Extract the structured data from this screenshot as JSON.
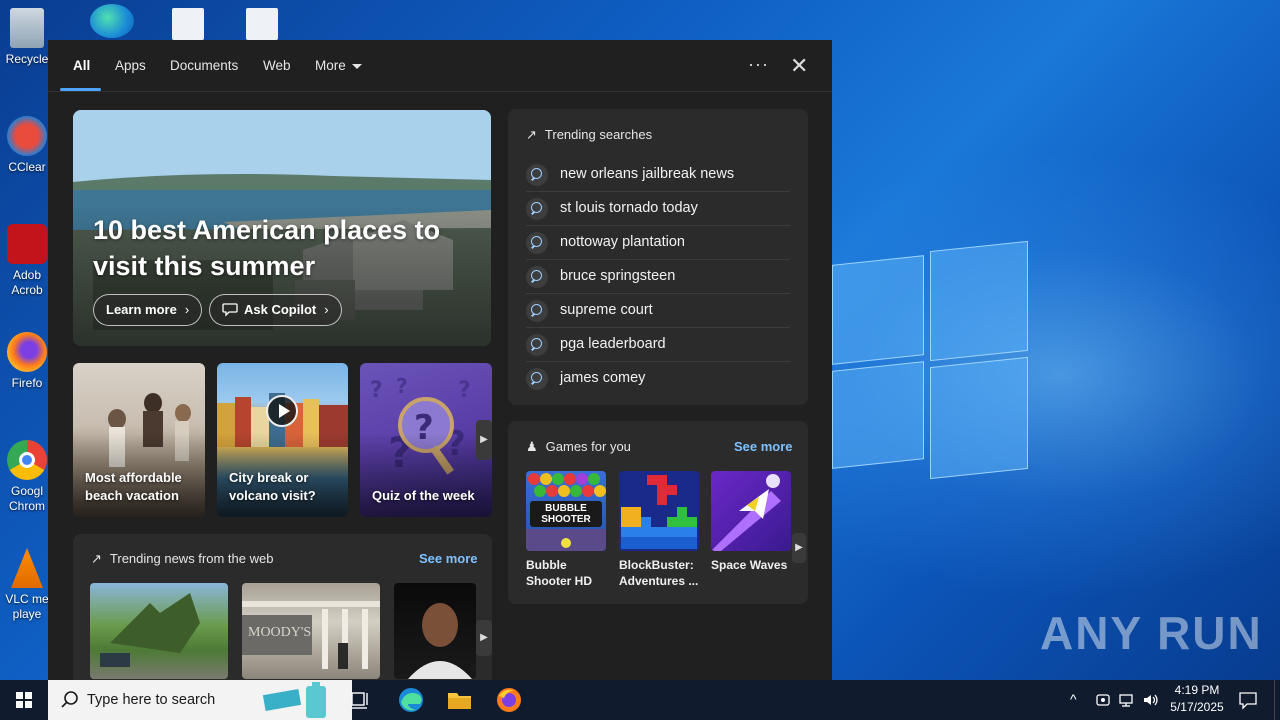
{
  "desktop": {
    "icons": [
      {
        "label": "Recycle",
        "name": "recycle-bin"
      },
      {
        "label": "CClear",
        "name": "ccleaner"
      },
      {
        "label": "Adob Acrob",
        "name": "adobe-acrobat"
      },
      {
        "label": "Firefo",
        "name": "firefox"
      },
      {
        "label": "Googl Chrom",
        "name": "google-chrome"
      },
      {
        "label": "VLC me playe",
        "name": "vlc-player"
      }
    ]
  },
  "panel": {
    "tabs": [
      {
        "label": "All",
        "active": true
      },
      {
        "label": "Apps"
      },
      {
        "label": "Documents"
      },
      {
        "label": "Web"
      },
      {
        "label": "More"
      }
    ],
    "options_icon": "···",
    "close_icon": "✕"
  },
  "hero": {
    "title": "10 best American places to visit this summer",
    "learn_more": "Learn more",
    "ask_copilot": "Ask Copilot"
  },
  "cards": [
    {
      "label": "Most affordable beach vacation"
    },
    {
      "label": "City break or volcano visit?"
    },
    {
      "label": "Quiz of the week"
    }
  ],
  "news": {
    "title": "Trending news from the web",
    "see_more": "See more",
    "thumb2_text": "MOODY'S"
  },
  "trending": {
    "title": "Trending searches",
    "items": [
      "new orleans jailbreak news",
      "st louis tornado today",
      "nottoway plantation",
      "bruce springsteen",
      "supreme court",
      "pga leaderboard",
      "james comey"
    ]
  },
  "games": {
    "title": "Games for you",
    "see_more": "See more",
    "items": [
      {
        "name": "Bubble Shooter HD",
        "art": "BUBBLE SHOOTER"
      },
      {
        "name": "BlockBuster: Adventures ..."
      },
      {
        "name": "Space Waves"
      }
    ]
  },
  "taskbar": {
    "search_placeholder": "Type here to search",
    "time": "4:19 PM",
    "date": "5/17/2025"
  },
  "watermark": "ANY RUN"
}
